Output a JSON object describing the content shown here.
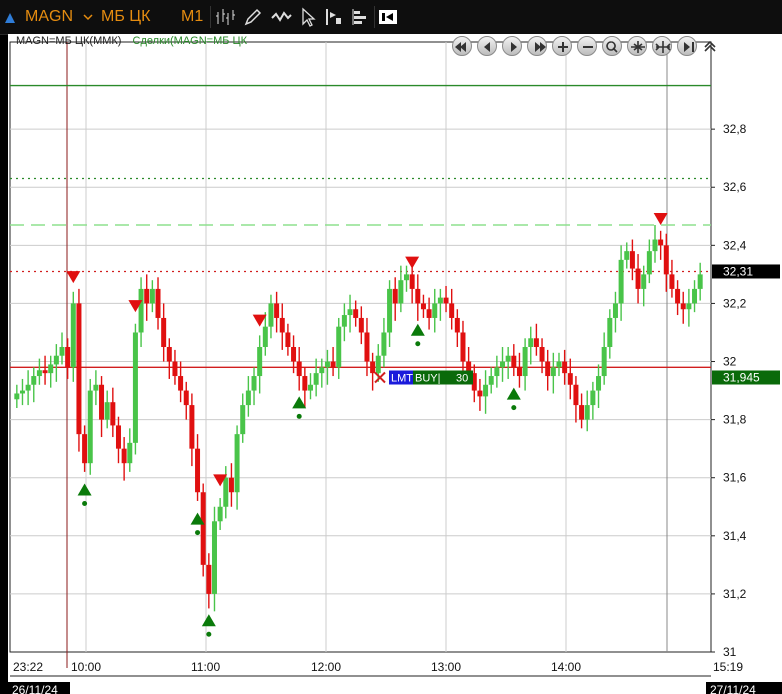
{
  "toolbar": {
    "ticker": "MAGN",
    "board": "МБ ЦК",
    "timeframe": "M1",
    "icons": [
      "up-triangle-icon",
      "chevron-down-icon",
      "candles-icon",
      "pencil-icon",
      "crossed-ticks-icon",
      "cursor-icon",
      "bar-indicator-icon",
      "histogram-icon",
      "trade-window-icon"
    ]
  },
  "chart_header": {
    "instrument": "MAGN=МБ ЦК(ММК)",
    "trades": "Сделки(MAGN=МБ ЦК"
  },
  "nav_buttons": [
    "scroll-first",
    "scroll-left",
    "scroll-right",
    "scroll-last",
    "zoom-in",
    "zoom-out",
    "zoom-fit",
    "compress",
    "expand",
    "go-end",
    "collapse"
  ],
  "colors": {
    "up": "#49c449",
    "down": "#e01010",
    "frame": "#000000",
    "grid": "#cccccc",
    "ask_line": "#d11e1e",
    "bid_line": "#2a8a2a",
    "label_green": "#0a6a0a"
  },
  "levels": {
    "last_price": "32,31",
    "order_price": "31,945",
    "order": {
      "type": "LMT",
      "side": "BUY|",
      "qty": "30"
    }
  },
  "x_axis": {
    "start": "26/11/24",
    "end": "27/11/24",
    "first_time": "23:22",
    "last_time": "15:19"
  },
  "chart_data": {
    "type": "candlestick",
    "title": "",
    "y_ticks": [
      "32,8",
      "32,6",
      "32,4",
      "32,2",
      "32",
      "31,8",
      "31,6",
      "31,4",
      "31,2",
      "31"
    ],
    "ylim": [
      31,
      33.1
    ],
    "x_ticks": [
      "10:00",
      "11:00",
      "12:00",
      "13:00",
      "14:00"
    ],
    "horizontal_lines": [
      {
        "value": 32.95,
        "style": "solid",
        "color": "#2a8a2a"
      },
      {
        "value": 32.63,
        "style": "dotted",
        "color": "#2a8a2a"
      },
      {
        "value": 32.47,
        "style": "dashed",
        "color": "#8ee08e"
      },
      {
        "value": 32.31,
        "style": "dotted",
        "color": "#d11e1e"
      },
      {
        "value": 31.98,
        "style": "solid",
        "color": "#d11e1e"
      }
    ],
    "series": [
      {
        "values": [
          31.89,
          31.9,
          31.92,
          31.95,
          31.97,
          31.96,
          31.99,
          32.02,
          32.05,
          31.98,
          32.2,
          31.75,
          31.65,
          31.9,
          31.92,
          31.8,
          31.86,
          31.78,
          31.7,
          31.65,
          31.72,
          32.1,
          32.25,
          32.2,
          32.25,
          32.15,
          32.05,
          32.0,
          31.95,
          31.9,
          31.85,
          31.7,
          31.55,
          31.3,
          31.2,
          31.45,
          31.5,
          31.6,
          31.55,
          31.75,
          31.85,
          31.9,
          31.95,
          32.05,
          32.12,
          32.2,
          32.15,
          32.1,
          32.05,
          32.0,
          31.95,
          31.9,
          31.92,
          31.96,
          31.98,
          32.0,
          31.98,
          32.12,
          32.16,
          32.18,
          32.15,
          32.1,
          32.0,
          31.96,
          32.02,
          32.1,
          32.25,
          32.2,
          32.28,
          32.3,
          32.25,
          32.2,
          32.18,
          32.15,
          32.2,
          32.22,
          32.2,
          32.15,
          32.1,
          32.0,
          31.96,
          31.9,
          31.88,
          31.92,
          31.95,
          31.98,
          32.0,
          32.02,
          31.98,
          31.95,
          32.05,
          32.08,
          32.05,
          32.0,
          31.95,
          31.98,
          32.0,
          31.96,
          31.92,
          31.85,
          31.8,
          31.85,
          31.9,
          31.95,
          32.05,
          32.15,
          32.2,
          32.35,
          32.38,
          32.32,
          32.25,
          32.3,
          32.38,
          32.42,
          32.4,
          32.3,
          32.25,
          32.2,
          32.18,
          32.2,
          32.25,
          32.3
        ]
      }
    ],
    "annotations": [
      {
        "marker": "sell",
        "time_index": 10
      },
      {
        "marker": "buy",
        "time_index": 12
      },
      {
        "marker": "sell",
        "time_index": 21
      },
      {
        "marker": "buy",
        "time_index": 32
      },
      {
        "marker": "buy",
        "time_index": 34
      },
      {
        "marker": "sell",
        "time_index": 36
      },
      {
        "marker": "sell",
        "time_index": 43
      },
      {
        "marker": "buy",
        "time_index": 50
      },
      {
        "marker": "sell",
        "time_index": 70
      },
      {
        "marker": "buy",
        "time_index": 71
      },
      {
        "marker": "buy",
        "time_index": 88
      },
      {
        "marker": "sell",
        "time_index": 114
      }
    ]
  }
}
